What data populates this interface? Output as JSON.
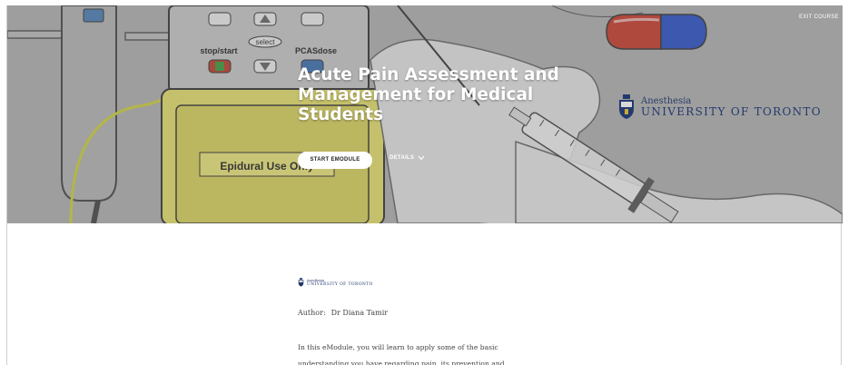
{
  "hero": {
    "title": "Acute Pain Assessment and Management for Medical Students",
    "exit_label": "EXIT COURSE",
    "start_label": "START EMODULE",
    "details_label": "DETAILS",
    "illustration": {
      "pump_label_stop": "stop/start",
      "pump_label_select": "select",
      "pump_label_pca": "PCASdose",
      "pump_sticker": "Epidural Use Only"
    },
    "logo": {
      "dept": "Anesthesia",
      "name": "UNIVERSITY OF TORONTO"
    }
  },
  "content": {
    "logo": {
      "dept": "Anesthesia",
      "name": "UNIVERSITY OF TORONTO"
    },
    "author_label": "Author:",
    "author_name": "Dr Diana Tamir",
    "intro": "In this eModule, you will learn to apply some of the basic understanding you have regarding pain, its prevention and"
  },
  "colors": {
    "hero_overlay": "#7a7a7a",
    "logo_blue": "#243a6e",
    "pump_yellow": "#e6e06a",
    "capsule_red": "#c83a2a",
    "capsule_blue": "#2a4fc8"
  }
}
